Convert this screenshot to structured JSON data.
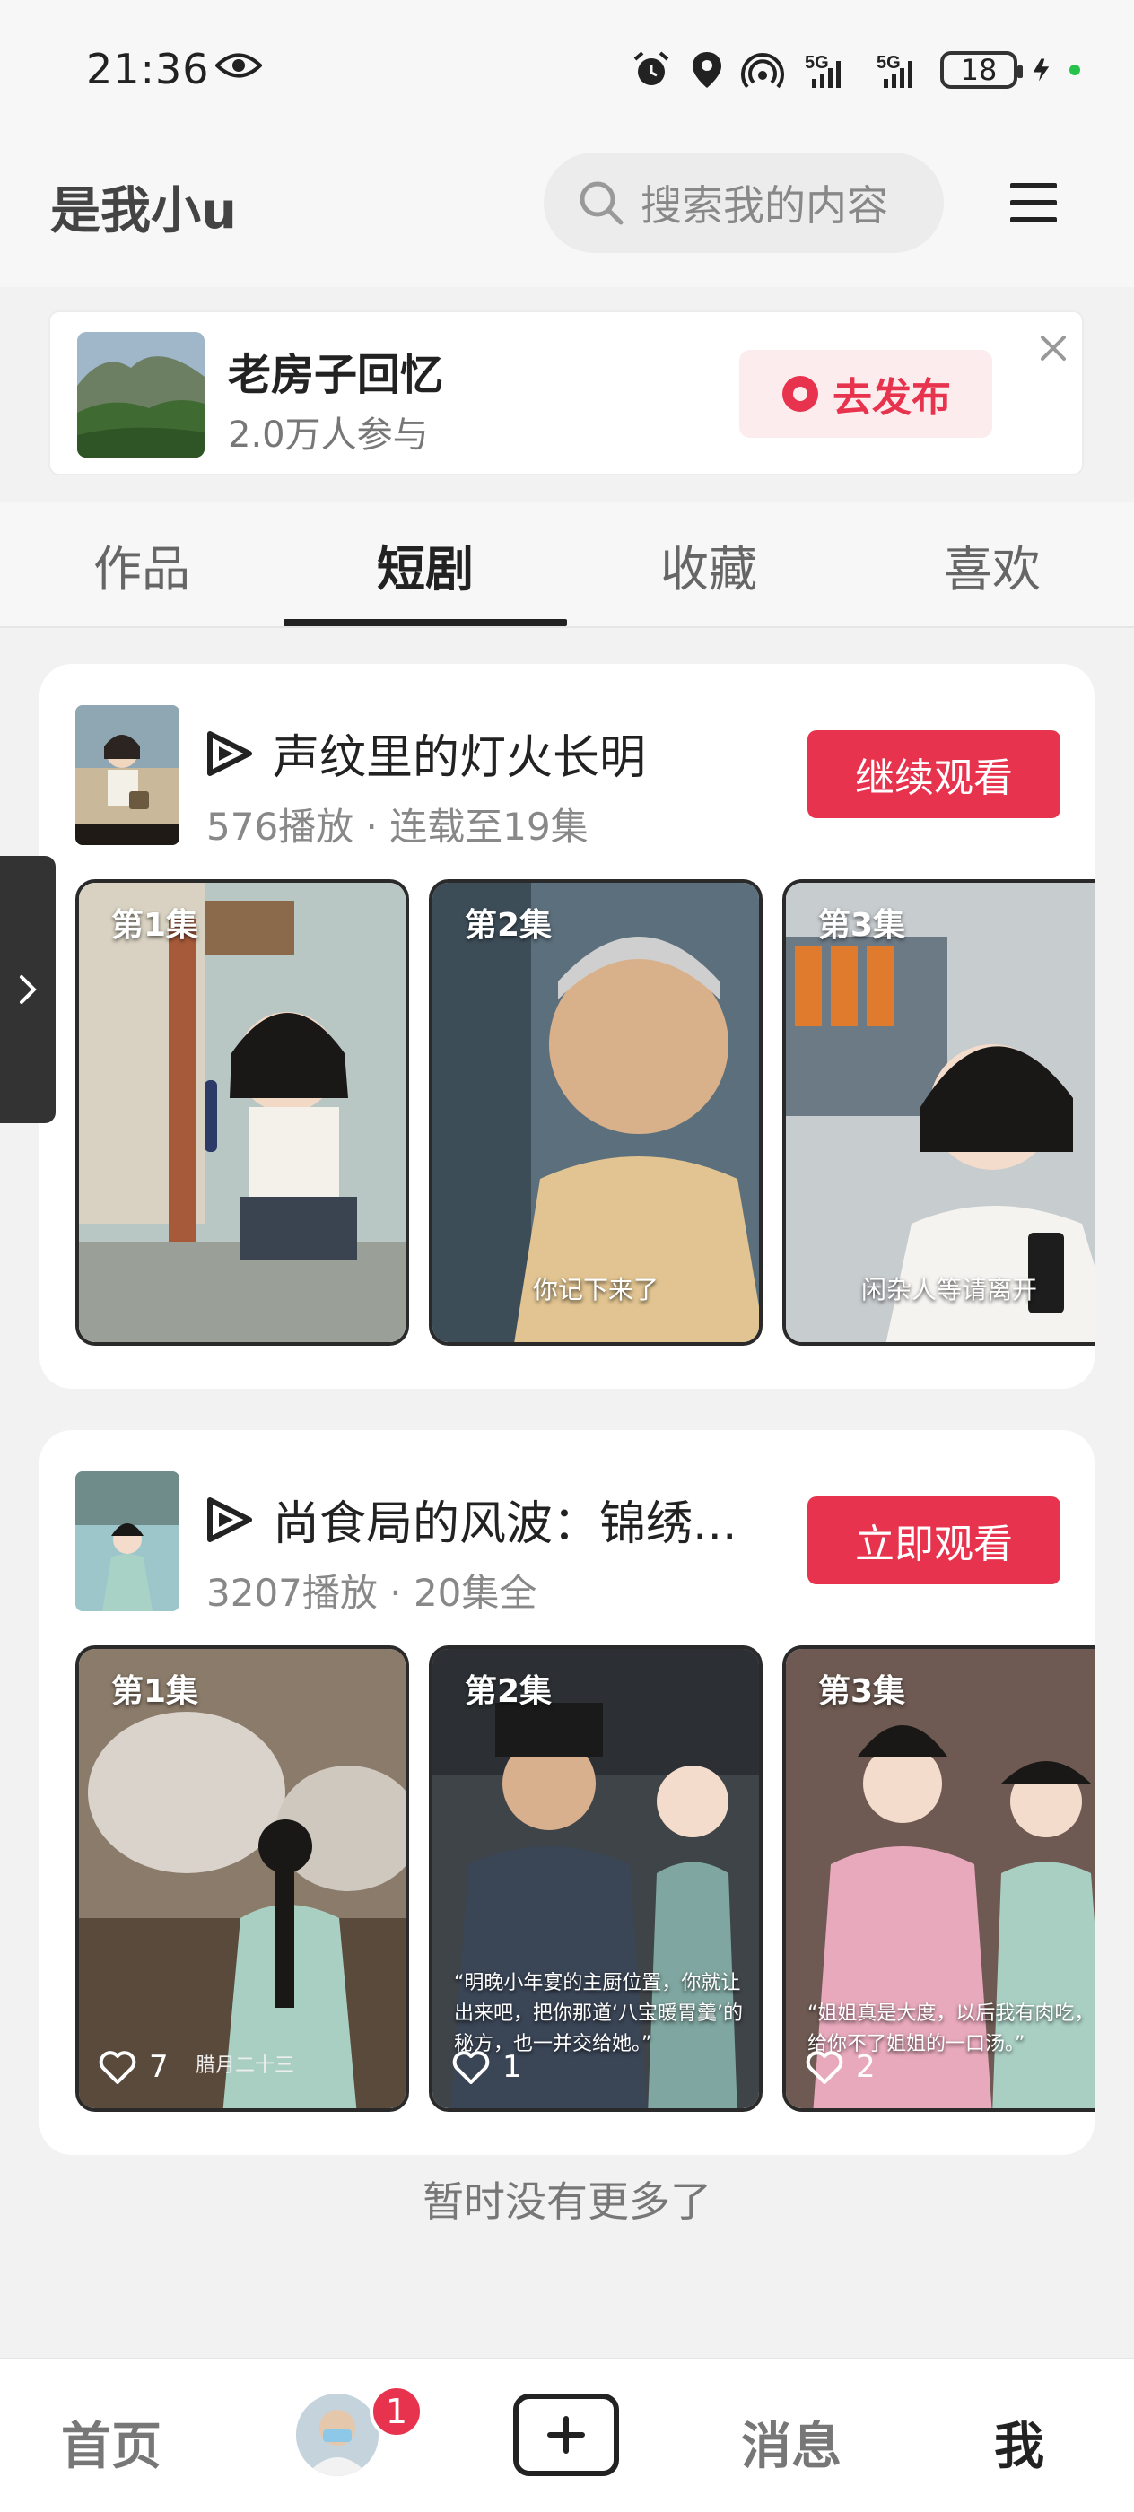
{
  "status_bar": {
    "time": "21:36",
    "battery": "18"
  },
  "header": {
    "user_name": "是我小u",
    "search_placeholder": "搜索我的内容"
  },
  "banner": {
    "title": "老房子回忆",
    "participants": "2.0万人参与",
    "publish_label": "去发布"
  },
  "tabs": [
    {
      "label": "作品",
      "active": false
    },
    {
      "label": "短剧",
      "active": true
    },
    {
      "label": "收藏",
      "active": false
    },
    {
      "label": "喜欢",
      "active": false
    }
  ],
  "dramas": [
    {
      "title": "声纹里的灯火长明",
      "meta": "576播放 · 连载至19集",
      "button": "继续观看",
      "cover_text": "声纹里的灯火长明",
      "episodes": [
        {
          "label": "第1集",
          "caption": ""
        },
        {
          "label": "第2集",
          "caption": "你记下来了"
        },
        {
          "label": "第3集",
          "caption": "闲杂人等请离开"
        }
      ]
    },
    {
      "title": "尚食局的风波：锦绣...",
      "meta": "3207播放 · 20集全",
      "button": "立即观看",
      "episodes": [
        {
          "label": "第1集",
          "likes": "7",
          "tag": "腊月二十三",
          "caption": ""
        },
        {
          "label": "第2集",
          "likes": "1",
          "caption": "“明晚小年宴的主厨位置，你就让出来吧，把你那道‘八宝暖胃羹’的秘方，也一并交给她。”"
        },
        {
          "label": "第3集",
          "likes": "2",
          "caption": "“姐姐真是大度，以后我有肉吃，给你不了姐姐的一口汤。”"
        }
      ]
    }
  ],
  "footer_text": "暂时没有更多了",
  "bottom_nav": {
    "home": "首页",
    "badge": "1",
    "messages": "消息",
    "me": "我"
  }
}
